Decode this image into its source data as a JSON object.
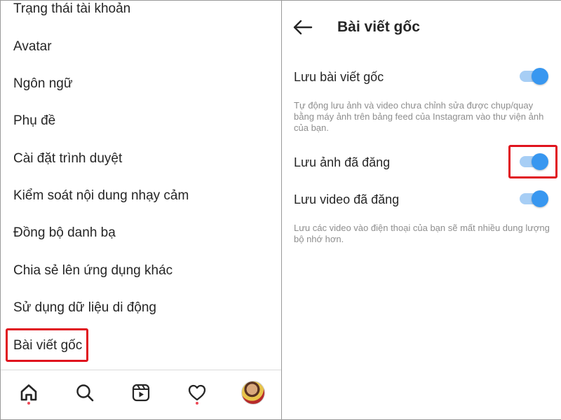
{
  "colors": {
    "accent": "#3897f0",
    "toggle_track": "#a7cef5",
    "highlight": "#e0141e",
    "notification_dot": "#ed4956",
    "text_primary": "#262626",
    "text_secondary": "#8e8e8e"
  },
  "settings_menu": {
    "items": [
      {
        "label": "Trạng thái tài khoản"
      },
      {
        "label": "Avatar"
      },
      {
        "label": "Ngôn ngữ"
      },
      {
        "label": "Phụ đề"
      },
      {
        "label": "Cài đặt trình duyệt"
      },
      {
        "label": "Kiểm soát nội dung nhạy cảm"
      },
      {
        "label": "Đồng bộ danh bạ"
      },
      {
        "label": "Chia sẻ lên ứng dụng khác"
      },
      {
        "label": "Sử dụng dữ liệu di động"
      },
      {
        "label": "Bài viết gốc"
      }
    ]
  },
  "bottom_nav": {
    "items": [
      {
        "icon": "home-icon",
        "has_dot": true
      },
      {
        "icon": "search-icon",
        "has_dot": false
      },
      {
        "icon": "reels-icon",
        "has_dot": false
      },
      {
        "icon": "heart-icon",
        "has_dot": true
      },
      {
        "icon": "profile-avatar",
        "has_dot": false
      }
    ]
  },
  "detail": {
    "back_icon": "arrow-left-icon",
    "title": "Bài viết gốc",
    "settings": [
      {
        "label": "Lưu bài viết gốc",
        "enabled": true,
        "description": "Tự động lưu ảnh và video chưa chỉnh sửa được chụp/quay bằng máy ảnh trên bảng feed của Instagram vào thư viện ảnh của bạn."
      },
      {
        "label": "Lưu ảnh đã đăng",
        "enabled": true,
        "description": ""
      },
      {
        "label": "Lưu video đã đăng",
        "enabled": true,
        "description": "Lưu các video vào điện thoại của bạn sẽ mất nhiều dung lượng bộ nhớ hơn."
      }
    ]
  }
}
